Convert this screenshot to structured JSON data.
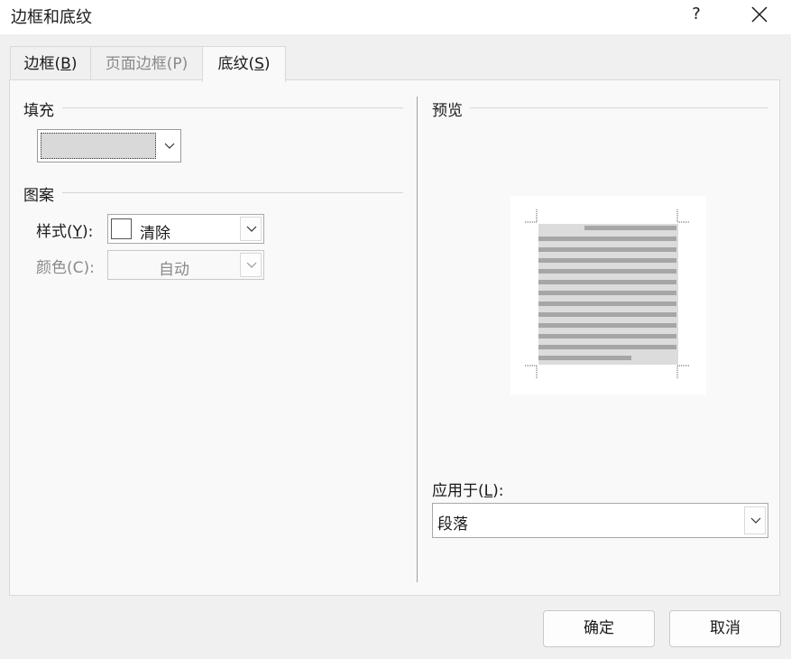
{
  "window": {
    "title": "边框和底纹",
    "help_label": "?"
  },
  "tabs": [
    {
      "label": "边框(",
      "mnemonic": "B",
      "suffix": ")",
      "state": "normal"
    },
    {
      "label": "页面边框(",
      "mnemonic": "P",
      "suffix": ")",
      "state": "disabled"
    },
    {
      "label": "底纹(",
      "mnemonic": "S",
      "suffix": ")",
      "state": "active"
    }
  ],
  "fill": {
    "group_label": "填充",
    "color": "#d9d9d9"
  },
  "pattern": {
    "group_label": "图案",
    "style_label": "样式(",
    "style_mnemonic": "Y",
    "style_suffix": "):",
    "style_value": "清除",
    "color_label": "颜色(C):",
    "color_value": "自动"
  },
  "preview": {
    "group_label": "预览",
    "shade_color": "#dcdcdc",
    "line_color": "#a6a6a6"
  },
  "apply_to": {
    "label": "应用于(",
    "mnemonic": "L",
    "suffix": "):",
    "value": "段落"
  },
  "buttons": {
    "ok": "确定",
    "cancel": "取消"
  }
}
